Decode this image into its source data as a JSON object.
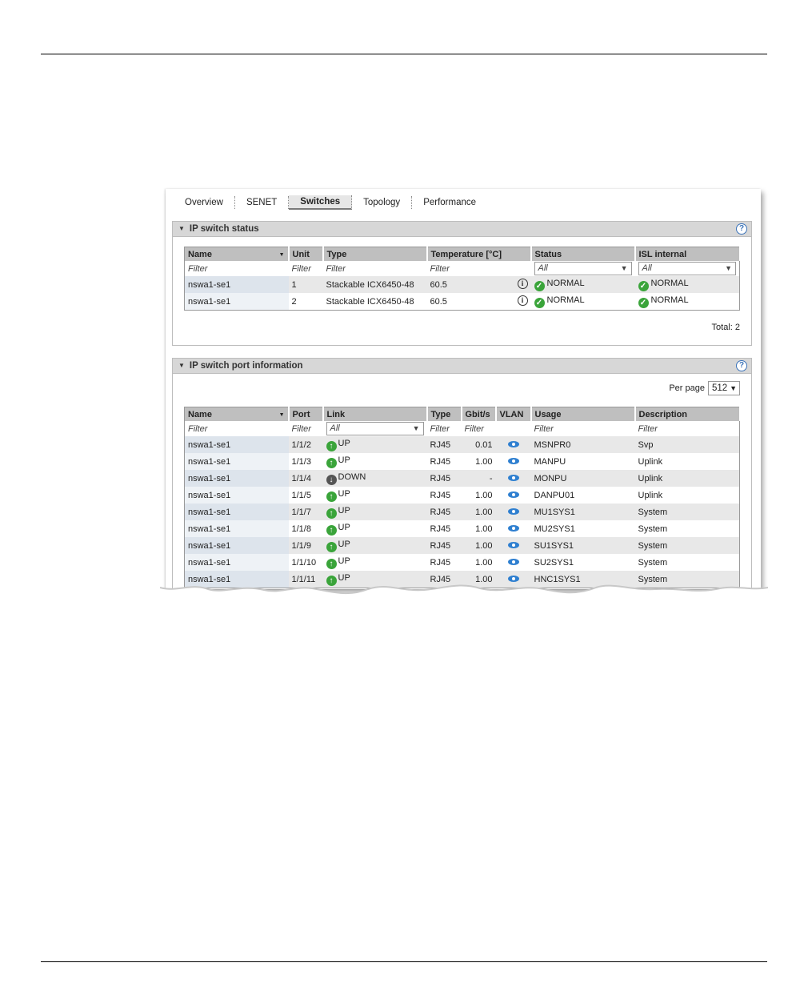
{
  "tabs": [
    {
      "label": "Overview",
      "active": false
    },
    {
      "label": "SENET",
      "active": false
    },
    {
      "label": "Switches",
      "active": true
    },
    {
      "label": "Topology",
      "active": false
    },
    {
      "label": "Performance",
      "active": false
    }
  ],
  "status_panel": {
    "title": "IP switch status",
    "columns": [
      "Name",
      "Unit",
      "Type",
      "Temperature [°C]",
      "Status",
      "ISL internal"
    ],
    "filters": [
      "Filter",
      "Filter",
      "Filter",
      "Filter",
      "All",
      "All"
    ],
    "rows": [
      {
        "name": "nswa1-se1",
        "unit": "1",
        "type": "Stackable ICX6450-48",
        "temp": "60.5",
        "status": "NORMAL",
        "isl": "NORMAL"
      },
      {
        "name": "nswa1-se1",
        "unit": "2",
        "type": "Stackable ICX6450-48",
        "temp": "60.5",
        "status": "NORMAL",
        "isl": "NORMAL"
      }
    ],
    "total": "Total: 2"
  },
  "port_panel": {
    "title": "IP switch port information",
    "per_page_label": "Per page",
    "per_page_value": "512",
    "columns": [
      "Name",
      "Port",
      "Link",
      "Type",
      "Gbit/s",
      "VLAN",
      "Usage",
      "Description"
    ],
    "filters": [
      "Filter",
      "Filter",
      "All",
      "Filter",
      "Filter",
      "",
      "Filter",
      "Filter"
    ],
    "rows": [
      {
        "name": "nswa1-se1",
        "port": "1/1/2",
        "link": "UP",
        "type": "RJ45",
        "gbit": "0.01",
        "usage": "MSNPR0",
        "desc": "Svp"
      },
      {
        "name": "nswa1-se1",
        "port": "1/1/3",
        "link": "UP",
        "type": "RJ45",
        "gbit": "1.00",
        "usage": "MANPU",
        "desc": "Uplink"
      },
      {
        "name": "nswa1-se1",
        "port": "1/1/4",
        "link": "DOWN",
        "type": "RJ45",
        "gbit": "-",
        "usage": "MONPU",
        "desc": "Uplink"
      },
      {
        "name": "nswa1-se1",
        "port": "1/1/5",
        "link": "UP",
        "type": "RJ45",
        "gbit": "1.00",
        "usage": "DANPU01",
        "desc": "Uplink"
      },
      {
        "name": "nswa1-se1",
        "port": "1/1/7",
        "link": "UP",
        "type": "RJ45",
        "gbit": "1.00",
        "usage": "MU1SYS1",
        "desc": "System"
      },
      {
        "name": "nswa1-se1",
        "port": "1/1/8",
        "link": "UP",
        "type": "RJ45",
        "gbit": "1.00",
        "usage": "MU2SYS1",
        "desc": "System"
      },
      {
        "name": "nswa1-se1",
        "port": "1/1/9",
        "link": "UP",
        "type": "RJ45",
        "gbit": "1.00",
        "usage": "SU1SYS1",
        "desc": "System"
      },
      {
        "name": "nswa1-se1",
        "port": "1/1/10",
        "link": "UP",
        "type": "RJ45",
        "gbit": "1.00",
        "usage": "SU2SYS1",
        "desc": "System"
      },
      {
        "name": "nswa1-se1",
        "port": "1/1/11",
        "link": "UP",
        "type": "RJ45",
        "gbit": "1.00",
        "usage": "HNC1SYS1",
        "desc": "System"
      }
    ]
  },
  "icons": {
    "collapse": "triangle-down-icon",
    "help": "help-icon",
    "ok": "check-circle-icon",
    "up": "arrow-up-circle-icon",
    "down": "arrow-down-circle-icon",
    "info": "info-icon",
    "vlan": "eye-icon"
  },
  "colors": {
    "ok": "#3aa43a",
    "vlan": "#2e7fd0",
    "help": "#3b73b9",
    "header": "#bfbfbf"
  }
}
